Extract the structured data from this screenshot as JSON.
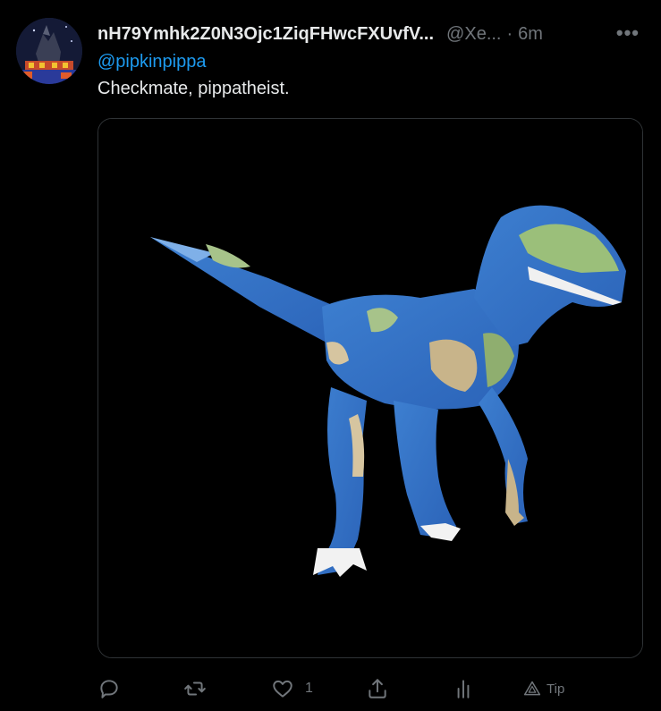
{
  "tweet": {
    "display_name": "nH79Ymhk2Z0N3Ojc1ZiqFHwcFXUvfV...",
    "handle": "@Xe...",
    "separator": "·",
    "time": "6m",
    "more_label": "•••",
    "mention": "@pipkinpippa",
    "text": "Checkmate, pippatheist."
  },
  "actions": {
    "reply_count": "",
    "retweet_count": "",
    "like_count": "1",
    "tip_label": "Tip"
  },
  "colors": {
    "accent": "#1d9bf0",
    "muted": "#71767b",
    "text": "#e7e9ea",
    "background": "#000000"
  }
}
